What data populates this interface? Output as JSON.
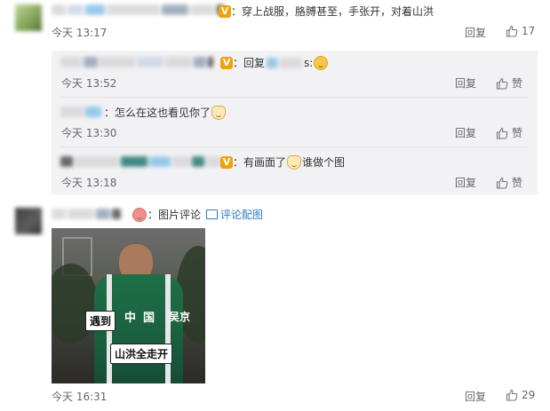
{
  "comments": [
    {
      "text": "：穿上战服，胳膊甚至，手张开，对着山洪",
      "time": "今天 13:17",
      "reply_label": "回复",
      "like_count": "17",
      "replies": [
        {
          "prefix": "：回复",
          "suffix": "s:",
          "time": "今天 13:52",
          "reply_label": "回复",
          "like_label": "赞"
        },
        {
          "text": "：怎么在这也看见你了",
          "time": "今天 13:30",
          "reply_label": "回复",
          "like_label": "赞"
        },
        {
          "text_a": "：有画面了",
          "text_b": "谁做个图",
          "time": "今天 13:18",
          "reply_label": "回复",
          "like_label": "赞"
        }
      ]
    },
    {
      "pic_label": "：图片评论",
      "pic_link": "评论配图",
      "image_captions": {
        "left": "遇到",
        "right": "吴京",
        "bottom": "山洪全走开",
        "jacket": "中国"
      },
      "time": "今天 16:31",
      "reply_label": "回复",
      "like_count": "29"
    }
  ],
  "icons": {
    "verified": "verified-badge-icon",
    "like": "thumbs-up-icon",
    "photo": "photo-icon",
    "emoji": "smile-emoji-icon"
  },
  "colors": {
    "link": "#2a7ecc",
    "verified": "#f0a20a",
    "reply_bg": "#f2f2f5"
  }
}
